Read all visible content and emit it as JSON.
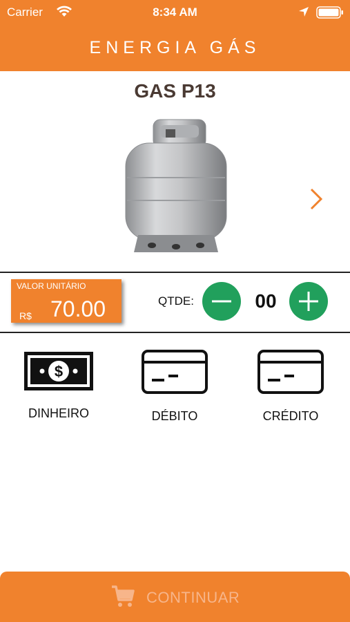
{
  "status_bar": {
    "carrier": "Carrier",
    "time": "8:34 AM",
    "icons": [
      "wifi-icon",
      "location-arrow-icon",
      "battery-icon"
    ]
  },
  "nav": {
    "title": "ENERGIA GÁS"
  },
  "product": {
    "title": "GAS P13",
    "image": "gas-cylinder",
    "next_icon": "chevron-right-icon"
  },
  "price": {
    "label": "VALOR UNITÁRIO",
    "currency": "R$",
    "value": "70.00"
  },
  "quantity": {
    "label": "QTDE:",
    "value": "00"
  },
  "payment_methods": [
    {
      "label": "DINHEIRO",
      "icon": "cash-icon"
    },
    {
      "label": "DÉBITO",
      "icon": "debit-card-icon"
    },
    {
      "label": "CRÉDITO",
      "icon": "credit-card-icon"
    }
  ],
  "footer": {
    "continue_label": "CONTINUAR",
    "icon": "cart-icon"
  },
  "colors": {
    "primary": "#f0822d",
    "green": "#21a05c",
    "title": "#4a3a33"
  }
}
